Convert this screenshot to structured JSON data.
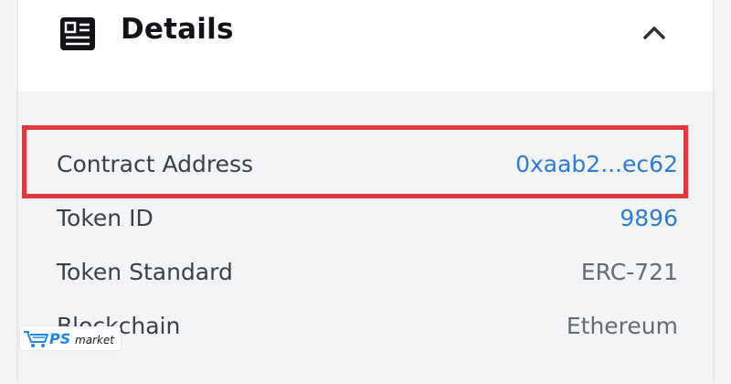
{
  "details": {
    "title": "Details",
    "rows": [
      {
        "label": "Contract Address",
        "value": "0xaab2...ec62"
      },
      {
        "label": "Token ID",
        "value": "9896"
      },
      {
        "label": "Token Standard",
        "value": "ERC-721"
      },
      {
        "label": "Blockchain",
        "value": "Ethereum"
      }
    ]
  },
  "watermark": {
    "brand": "PS",
    "text": "market"
  },
  "icons": {
    "header": "details-list-icon",
    "collapse": "chevron-up-icon",
    "watermark": "shopping-cart-icon"
  },
  "colors": {
    "link": "#2e7bd8",
    "highlight": "#e0393d",
    "watermark": "#1e88e5"
  }
}
